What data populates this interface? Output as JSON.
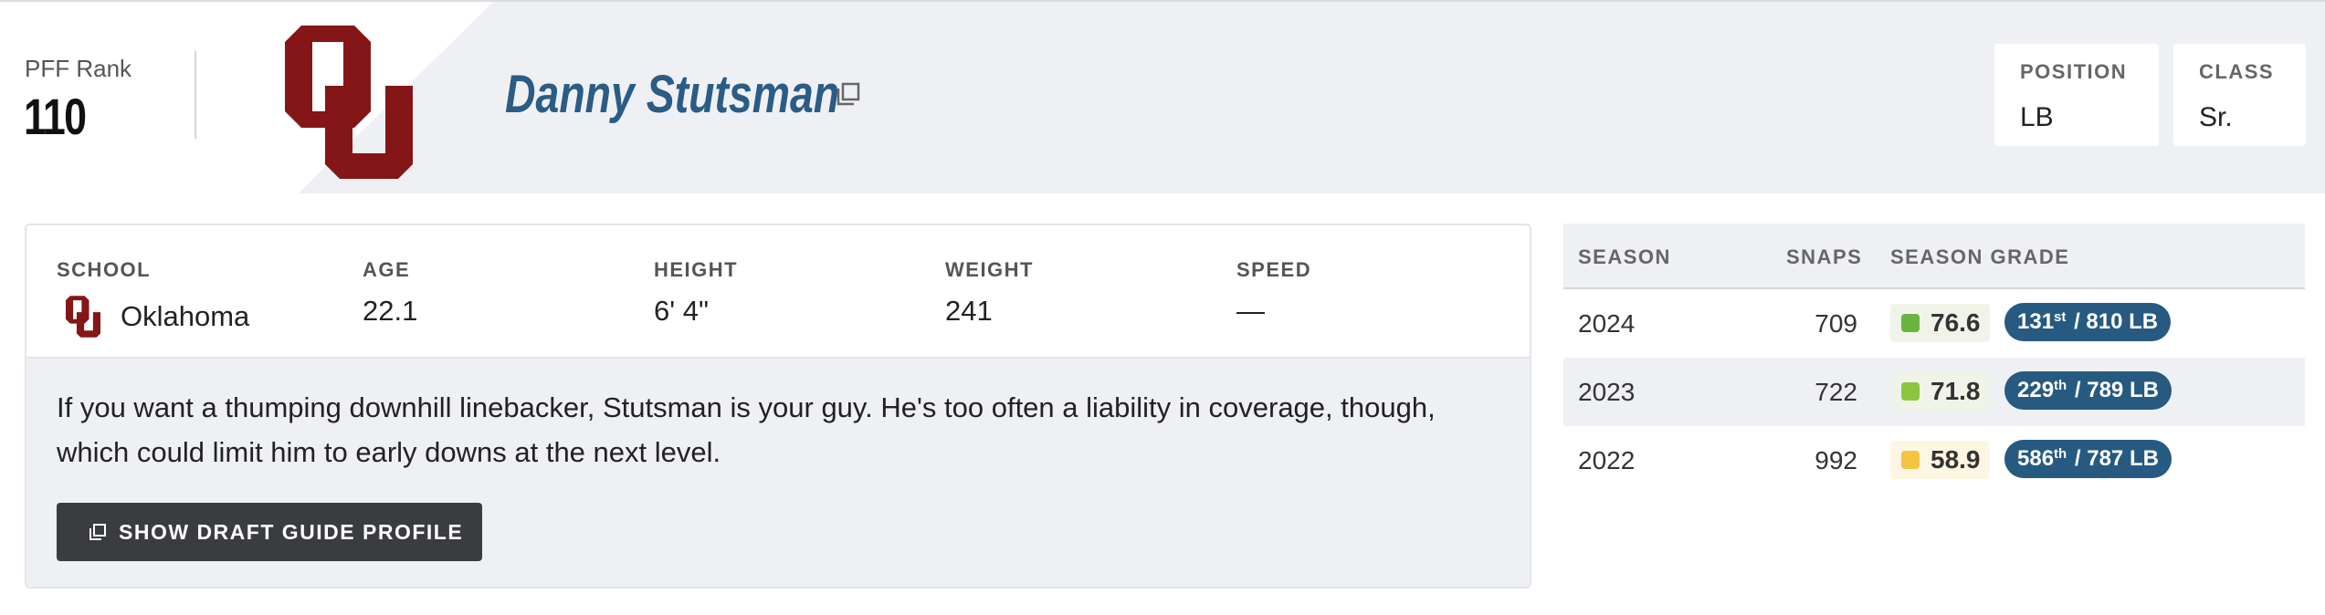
{
  "header": {
    "rank_label": "PFF Rank",
    "rank_value": "110",
    "player_name": "Danny Stutsman",
    "position_label": "POSITION",
    "position_value": "LB",
    "class_label": "CLASS",
    "class_value": "Sr."
  },
  "info": {
    "school_label": "SCHOOL",
    "school_value": "Oklahoma",
    "age_label": "AGE",
    "age_value": "22.1",
    "height_label": "HEIGHT",
    "height_value": "6' 4\"",
    "weight_label": "WEIGHT",
    "weight_value": "241",
    "speed_label": "SPEED",
    "speed_value": "—",
    "summary": "If you want a thumping downhill linebacker, Stutsman is your guy. He's too often a liability in coverage, though, which could limit him to early downs at the next level.",
    "profile_button": "SHOW DRAFT GUIDE PROFILE"
  },
  "grades": {
    "headers": {
      "season": "SEASON",
      "snaps": "SNAPS",
      "grade": "SEASON GRADE"
    },
    "rows": [
      {
        "season": "2024",
        "snaps": "709",
        "grade": "76.6",
        "grade_color": "#6cb33f",
        "rank": "131",
        "rank_suffix": "st",
        "rank_total": "/ 810 LB"
      },
      {
        "season": "2023",
        "snaps": "722",
        "grade": "71.8",
        "grade_color": "#8cc640",
        "rank": "229",
        "rank_suffix": "th",
        "rank_total": "/ 789 LB"
      },
      {
        "season": "2022",
        "snaps": "992",
        "grade": "58.9",
        "grade_color": "#f5c542",
        "rank": "586",
        "rank_suffix": "th",
        "rank_total": "/ 787 LB"
      }
    ]
  },
  "colors": {
    "team_crimson": "#841617",
    "name_blue": "#2a5c86",
    "rank_pill": "#265a80",
    "button_dark": "#3a3c40"
  },
  "icons": {
    "team_logo": "oklahoma-ou-logo",
    "external_link": "open-in-new-icon"
  }
}
